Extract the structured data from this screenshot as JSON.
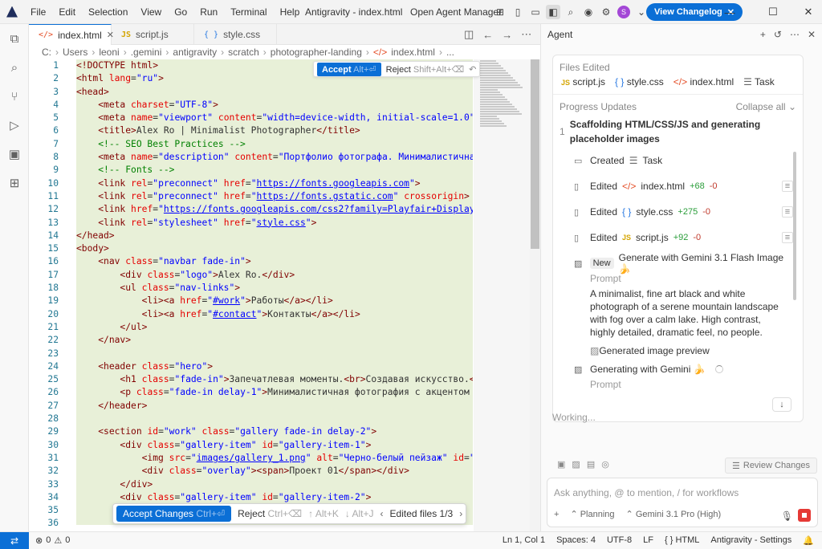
{
  "titlebar": {
    "menu": [
      "File",
      "Edit",
      "Selection",
      "View",
      "Go",
      "Run",
      "Terminal",
      "Help"
    ],
    "title": "Antigravity - index.html",
    "open_agent": "Open Agent Manager",
    "avatar": "S",
    "changelog": "View Changelog"
  },
  "tabs": [
    {
      "label": "index.html",
      "icon": "</>"
    },
    {
      "label": "script.js",
      "icon": "JS"
    },
    {
      "label": "style.css",
      "icon": "{ }"
    }
  ],
  "breadcrumb": [
    "C:",
    "Users",
    "leoni",
    ".gemini",
    "antigravity",
    "scratch",
    "photographer-landing",
    "index.html",
    "..."
  ],
  "inline_review": {
    "accept": "Accept",
    "accept_key": "Alt+⏎",
    "reject": "Reject",
    "reject_key": "Shift+Alt+⌫"
  },
  "changes_bar": {
    "accept": "Accept Changes",
    "accept_key": "Ctrl+⏎",
    "reject": "Reject",
    "reject_key": "Ctrl+⌫",
    "prev": "↑ Alt+K",
    "next": "↓ Alt+J",
    "files": "Edited files 1/3"
  },
  "code": {
    "line_numbers": [
      "1",
      "2",
      "3",
      "4",
      "5",
      "6",
      "7",
      "8",
      "9",
      "10",
      "11",
      "12",
      "13",
      "14",
      "15",
      "16",
      "17",
      "18",
      "19",
      "20",
      "21",
      "22",
      "23",
      "24",
      "25",
      "26",
      "27",
      "28",
      "29",
      "30",
      "31",
      "32",
      "33",
      "34",
      "35",
      "36"
    ]
  },
  "agent": {
    "title": "Agent",
    "files_edited_label": "Files Edited",
    "files_edited": [
      "script.js",
      "style.css",
      "index.html",
      "Task"
    ],
    "progress_label": "Progress Updates",
    "collapse": "Collapse all",
    "step_num": "1",
    "step_title": "Scaffolding HTML/CSS/JS and generating placeholder images",
    "created": "Created",
    "created_target": "Task",
    "edited_label": "Edited",
    "edits": [
      {
        "file": "index.html",
        "added": "+68",
        "removed": "-0"
      },
      {
        "file": "style.css",
        "added": "+275",
        "removed": "-0"
      },
      {
        "file": "script.js",
        "added": "+92",
        "removed": "-0"
      }
    ],
    "new_badge": "New",
    "generate_label": "Generate with Gemini 3.1 Flash Image 🍌",
    "prompt_label": "Prompt",
    "prompt_text": "A minimalist, fine art black and white photograph of a serene mountain landscape with fog over a calm lake. High contrast, highly detailed, dramatic feel, no people.",
    "preview_alt": "Generated image preview",
    "generating": "Generating with Gemini 🍌",
    "prompt_label2": "Prompt",
    "working": "Working...",
    "review_changes": "Review Changes",
    "input_placeholder": "Ask anything, @ to mention, / for workflows",
    "mode": "Planning",
    "model": "Gemini 3.1 Pro (High)"
  },
  "statusbar": {
    "errors": "0",
    "warnings": "0",
    "position": "Ln 1, Col 1",
    "spaces": "Spaces: 4",
    "encoding": "UTF-8",
    "eol": "LF",
    "language": "HTML",
    "settings": "Antigravity - Settings"
  }
}
